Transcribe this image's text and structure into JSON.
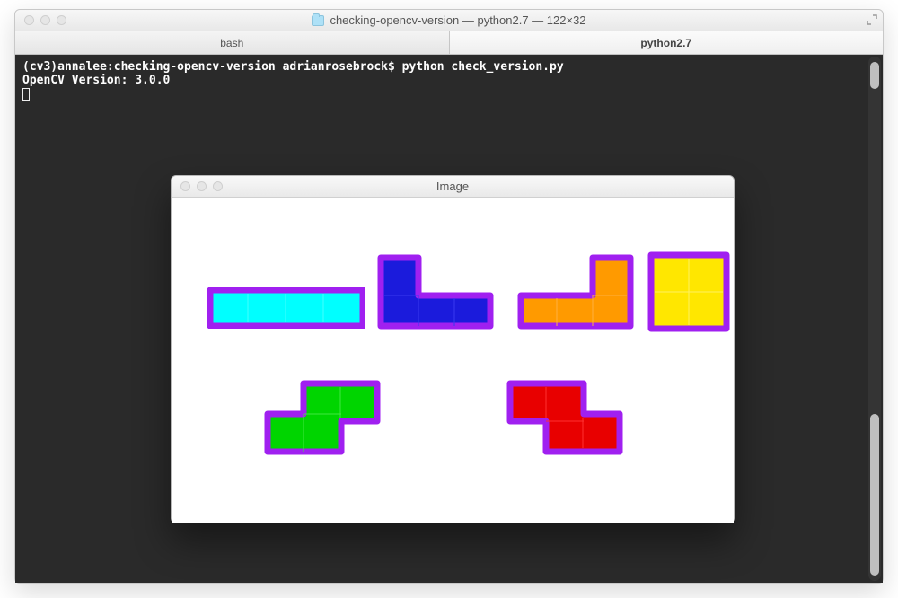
{
  "window": {
    "title": "checking-opencv-version — python2.7 — 122×32"
  },
  "tabs": [
    {
      "label": "bash",
      "active": false
    },
    {
      "label": "python2.7",
      "active": true
    }
  ],
  "terminal": {
    "prompt": "(cv3)annalee:checking-opencv-version adrianrosebrock$ ",
    "command": "python check_version.py",
    "output": "OpenCV Version: 3.0.0"
  },
  "image_window": {
    "title": "Image"
  },
  "colors": {
    "outline": "#a020f0",
    "cyan": "#00ffff",
    "blue": "#1b1bdc",
    "orange": "#ff9a00",
    "yellow": "#ffe700",
    "green": "#00d500",
    "red": "#e80000"
  },
  "shapes": [
    {
      "name": "I-piece",
      "color": "cyan"
    },
    {
      "name": "J-piece",
      "color": "blue"
    },
    {
      "name": "L-piece",
      "color": "orange"
    },
    {
      "name": "O-piece",
      "color": "yellow"
    },
    {
      "name": "S-piece",
      "color": "green"
    },
    {
      "name": "Z-piece",
      "color": "red"
    }
  ]
}
